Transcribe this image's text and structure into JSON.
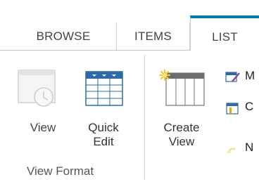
{
  "tabs": [
    {
      "label": "BROWSE"
    },
    {
      "label": "ITEMS"
    },
    {
      "label": "LIST"
    }
  ],
  "ribbon": {
    "group_label": "View Format",
    "buttons": [
      {
        "line1": "View",
        "line2": ""
      },
      {
        "line1": "Quick",
        "line2": "Edit"
      },
      {
        "line1": "Create",
        "line2": "View"
      }
    ],
    "side_items": [
      {
        "label": "M",
        "icon": "modify-view-icon"
      },
      {
        "label": "C",
        "icon": "current-view-icon"
      },
      {
        "label": "N",
        "icon": "navigate-icon"
      }
    ]
  },
  "colors": {
    "accent": "#0079ad",
    "grid_header": "#2e6aa6"
  }
}
